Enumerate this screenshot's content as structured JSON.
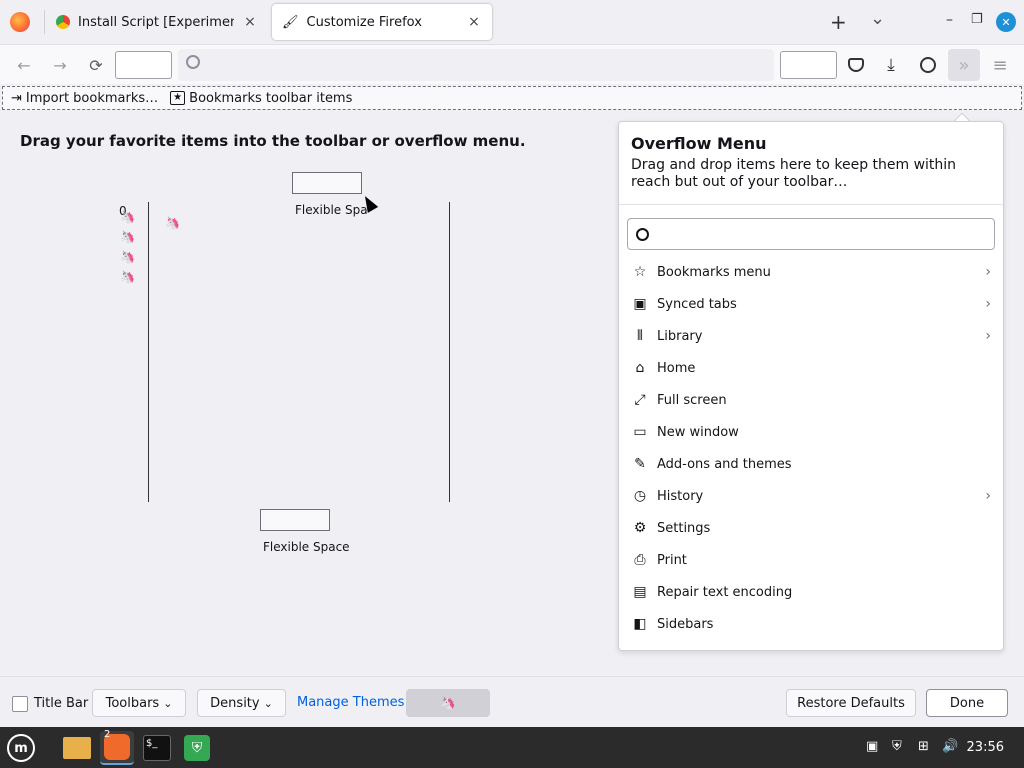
{
  "tabs": [
    {
      "title": "Install Script [Experimental]",
      "close": "×"
    },
    {
      "title": "Customize Firefox",
      "close": "×"
    }
  ],
  "tab_strip": {
    "new_tab": "+",
    "list_all": "⌄",
    "minimize": "–",
    "restore": "❐",
    "close": "✕"
  },
  "navbar": {
    "back": "←",
    "forward": "→",
    "reload": "⟳",
    "search_icon": "🔍"
  },
  "bookmarks_toolbar": {
    "import": "Import bookmarks…",
    "items": "Bookmarks toolbar items"
  },
  "palette": {
    "heading": "Drag your favorite items into the toolbar or overflow menu.",
    "flex_top": "Flexible Space",
    "flex_bottom": "Flexible Space",
    "zero": "0"
  },
  "overflow": {
    "title": "Overflow Menu",
    "description": "Drag and drop items here to keep them within reach but out of your toolbar…",
    "items": [
      {
        "label": "Bookmarks menu",
        "icon": "☆",
        "chevron": true
      },
      {
        "label": "Synced tabs",
        "icon": "▣",
        "chevron": true
      },
      {
        "label": "Library",
        "icon": "⫴",
        "chevron": true
      },
      {
        "label": "Home",
        "icon": "⌂",
        "chevron": false
      },
      {
        "label": "Full screen",
        "icon": "⤢",
        "chevron": false
      },
      {
        "label": "New window",
        "icon": "▭",
        "chevron": false
      },
      {
        "label": "Add-ons and themes",
        "icon": "✎",
        "chevron": false
      },
      {
        "label": "History",
        "icon": "◷",
        "chevron": true
      },
      {
        "label": "Settings",
        "icon": "⚙",
        "chevron": false
      },
      {
        "label": "Print",
        "icon": "⎙",
        "chevron": false
      },
      {
        "label": "Repair text encoding",
        "icon": "▤",
        "chevron": false
      },
      {
        "label": "Sidebars",
        "icon": "◧",
        "chevron": false
      }
    ]
  },
  "bottom": {
    "title_bar": "Title Bar",
    "toolbars": "Toolbars",
    "density": "Density",
    "manage_themes": "Manage Themes",
    "restore_defaults": "Restore Defaults",
    "done": "Done"
  },
  "taskbar": {
    "badge": "2",
    "clock": "23:56"
  }
}
